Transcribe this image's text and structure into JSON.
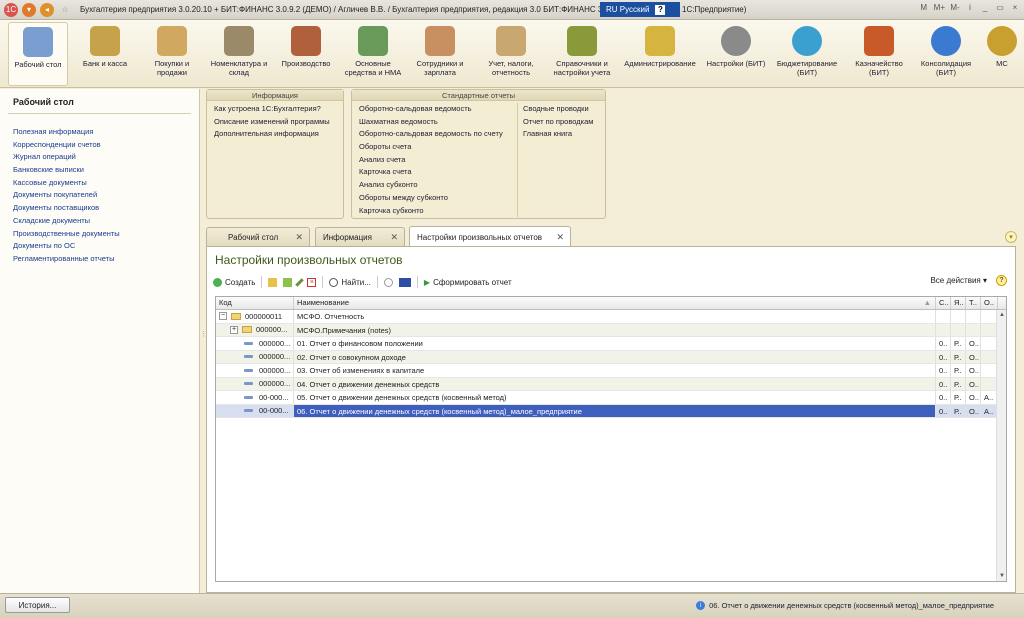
{
  "window": {
    "title": "Бухгалтерия предприятия 3.0.20.10 + БИТ:ФИНАНС 3.0.9.2 (ДЕМО) / Агличев В.В. / Бухгалтерия предприятия, редакция 3.0  БИТ:ФИНАНС 3.",
    "title_tail": "1С:Предприятие)",
    "lang_label": "RU Русский",
    "lang_help": "?",
    "controls": [
      "M",
      "M+",
      "M-",
      "i",
      "_",
      "▭",
      "×"
    ]
  },
  "sections": [
    {
      "label": "Рабочий стол",
      "icon": "desktop-icon",
      "color": "#7a9ecf"
    },
    {
      "label": "Банк и касса",
      "icon": "bank-icon",
      "color": "#c6a24a"
    },
    {
      "label": "Покупки и продажи",
      "icon": "truck-icon",
      "color": "#d0a860"
    },
    {
      "label": "Номенклатура и склад",
      "icon": "warehouse-icon",
      "color": "#9a8a6a"
    },
    {
      "label": "Производство",
      "icon": "toolbox-icon",
      "color": "#b0603a"
    },
    {
      "label": "Основные средства и НМА",
      "icon": "assets-icon",
      "color": "#6a9a5a"
    },
    {
      "label": "Сотрудники и зарплата",
      "icon": "employee-icon",
      "color": "#c89060"
    },
    {
      "label": "Учет, налоги, отчетность",
      "icon": "taxes-icon",
      "color": "#c8a870"
    },
    {
      "label": "Справочники и настройки учета",
      "icon": "books-icon",
      "color": "#8a9a3a"
    },
    {
      "label": "Администрирование",
      "icon": "database-icon",
      "color": "#d6b440"
    },
    {
      "label": "Настройки (БИТ)",
      "icon": "gear-icon",
      "color": "#8a8a8a"
    },
    {
      "label": "Бюджетирование (БИТ)",
      "icon": "pie-chart-icon",
      "color": "#3aa0d0"
    },
    {
      "label": "Казначейство (БИТ)",
      "icon": "treasure-chest-icon",
      "color": "#c85a2a"
    },
    {
      "label": "Консолидация (БИТ)",
      "icon": "globe-icon",
      "color": "#3a7ad0"
    },
    {
      "label": "МС",
      "icon": "more-icon",
      "color": "#c8a030"
    }
  ],
  "left_panel": {
    "title": "Рабочий стол",
    "items": [
      "Полезная информация",
      "Корреспонденции счетов",
      "Журнал операций",
      "Банковские выписки",
      "Кассовые документы",
      "Документы покупателей",
      "Документы поставщиков",
      "Складские документы",
      "Производственные документы",
      "Документы по ОС",
      "Регламентированные отчеты"
    ]
  },
  "info_box": {
    "title": "Информация",
    "links": [
      "Как устроена 1С:Бухгалтерия?",
      "Описание изменений программы",
      "Дополнительная информация"
    ]
  },
  "reports_box": {
    "title": "Стандартные отчеты",
    "col1": [
      "Оборотно-сальдовая ведомость",
      "Шахматная ведомость",
      "Оборотно-сальдовая ведомость по счету",
      "Обороты счета",
      "Анализ счета",
      "Карточка счета",
      "Анализ субконто",
      "Обороты между субконто",
      "Карточка субконто"
    ],
    "col2": [
      "Сводные проводки",
      "Отчет по проводкам",
      "Главная книга"
    ]
  },
  "tabs": [
    {
      "label": "Рабочий стол"
    },
    {
      "label": "Информация"
    },
    {
      "label": "Настройки произвольных отчетов"
    }
  ],
  "main": {
    "title": "Настройки произвольных отчетов",
    "toolbar": {
      "create": "Создать",
      "find": "Найти...",
      "generate": "Сформировать отчет",
      "all_actions": "Все действия ▾",
      "help": "?"
    },
    "columns": {
      "code": "Код",
      "name": "Наименование",
      "c1": "С..",
      "c2": "Я..",
      "c3": "Т..",
      "c4": "О.."
    },
    "rows": [
      {
        "code": "000000011",
        "name": "МСФО. Отчетность",
        "c1": "",
        "c2": "",
        "c3": "",
        "c4": ""
      },
      {
        "code": "000000...",
        "name": "МСФО.Примечания (notes)",
        "c1": "",
        "c2": "",
        "c3": "",
        "c4": ""
      },
      {
        "code": "000000...",
        "name": "01. Отчет о финансовом положении",
        "c1": "0..",
        "c2": "Р..",
        "c3": "О..",
        "c4": ""
      },
      {
        "code": "000000...",
        "name": "02. Отчет о совокупном доходе",
        "c1": "0..",
        "c2": "Р..",
        "c3": "О..",
        "c4": ""
      },
      {
        "code": "000000...",
        "name": "03. Отчет об изменениях в капитале",
        "c1": "0..",
        "c2": "Р..",
        "c3": "О..",
        "c4": ""
      },
      {
        "code": "000000...",
        "name": "04. Отчет о движении денежных средств",
        "c1": "0..",
        "c2": "Р..",
        "c3": "О..",
        "c4": ""
      },
      {
        "code": "00-000...",
        "name": "05. Отчет о движении денежных средств (косвенный метод)",
        "c1": "0..",
        "c2": "Р..",
        "c3": "О..",
        "c4": "А.."
      },
      {
        "code": "00-000...",
        "name": "06. Отчет о движении денежных средств (косвенный метод)_малое_предприятие",
        "c1": "0..",
        "c2": "Р..",
        "c3": "О..",
        "c4": "А.."
      }
    ]
  },
  "status": {
    "history_button": "История...",
    "message": "06. Отчет о движении денежных средств (косвенный метод)_малое_предприятие"
  }
}
